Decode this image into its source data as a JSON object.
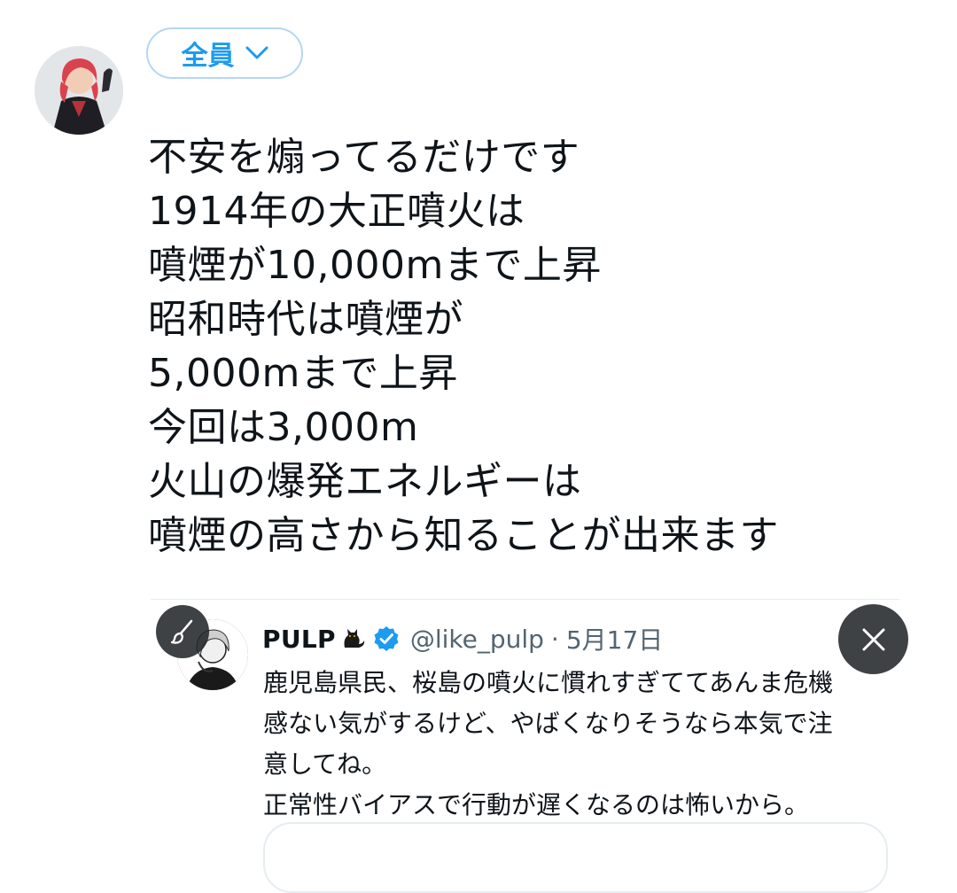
{
  "composer": {
    "avatar_icon": "user-avatar-icon",
    "audience_label": "全員",
    "audience_icon": "chevron-down-icon",
    "accent_color": "#1d9bf0",
    "text_lines": [
      "不安を煽ってるだけです",
      "1914年の大正噴火は",
      "噴煙が10,000mまで上昇",
      "昭和時代は噴煙が",
      "5,000mまで上昇",
      "今回は3,000m",
      "火山の爆発エネルギーは",
      "噴煙の高さから知ることが出来ます"
    ]
  },
  "quoted_tweet": {
    "display_name": "PULP",
    "name_emoji": "black-cat-icon",
    "verified_icon": "verified-badge-icon",
    "handle": "@like_pulp",
    "separator": "·",
    "date": "5月17日",
    "text_lines": [
      "鹿児島県民、桜島の噴火に慣れすぎててあんま危機",
      "感ない気がするけど、やばくなりそうなら本気で注",
      "意してね。",
      "正常性バイアスで行動が遅くなるのは怖いから。"
    ]
  },
  "controls": {
    "edit_icon": "brush-icon",
    "close_icon": "close-icon"
  }
}
